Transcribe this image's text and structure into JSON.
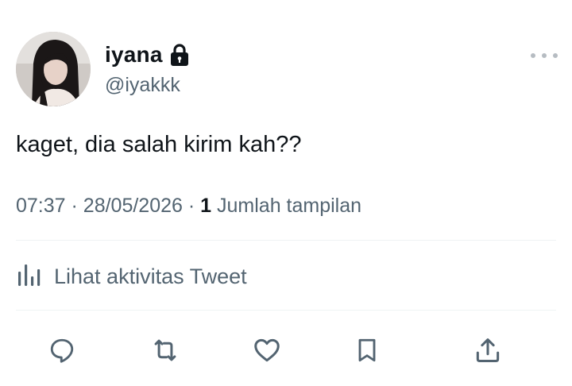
{
  "user": {
    "display_name": "iyana",
    "handle": "@iyakkk",
    "protected_icon": "lock-icon"
  },
  "tweet": {
    "text": "kaget, dia salah kirim kah??"
  },
  "meta": {
    "time": "07:37",
    "separator": "·",
    "date": "28/05/2026",
    "views_count": "1",
    "views_label": "Jumlah tampilan"
  },
  "activity": {
    "icon": "analytics-bars-icon",
    "label": "Lihat aktivitas Tweet"
  },
  "actions": [
    {
      "name": "reply",
      "icon": "reply-bubble-icon"
    },
    {
      "name": "retweet",
      "icon": "retweet-icon"
    },
    {
      "name": "like",
      "icon": "heart-icon"
    },
    {
      "name": "bookmark",
      "icon": "bookmark-icon"
    },
    {
      "name": "share",
      "icon": "share-upload-icon"
    }
  ],
  "colors": {
    "primary_text": "#0f1419",
    "secondary_text": "#536471",
    "divider": "#eff3f4",
    "more_dots": "#b6bcc2"
  }
}
